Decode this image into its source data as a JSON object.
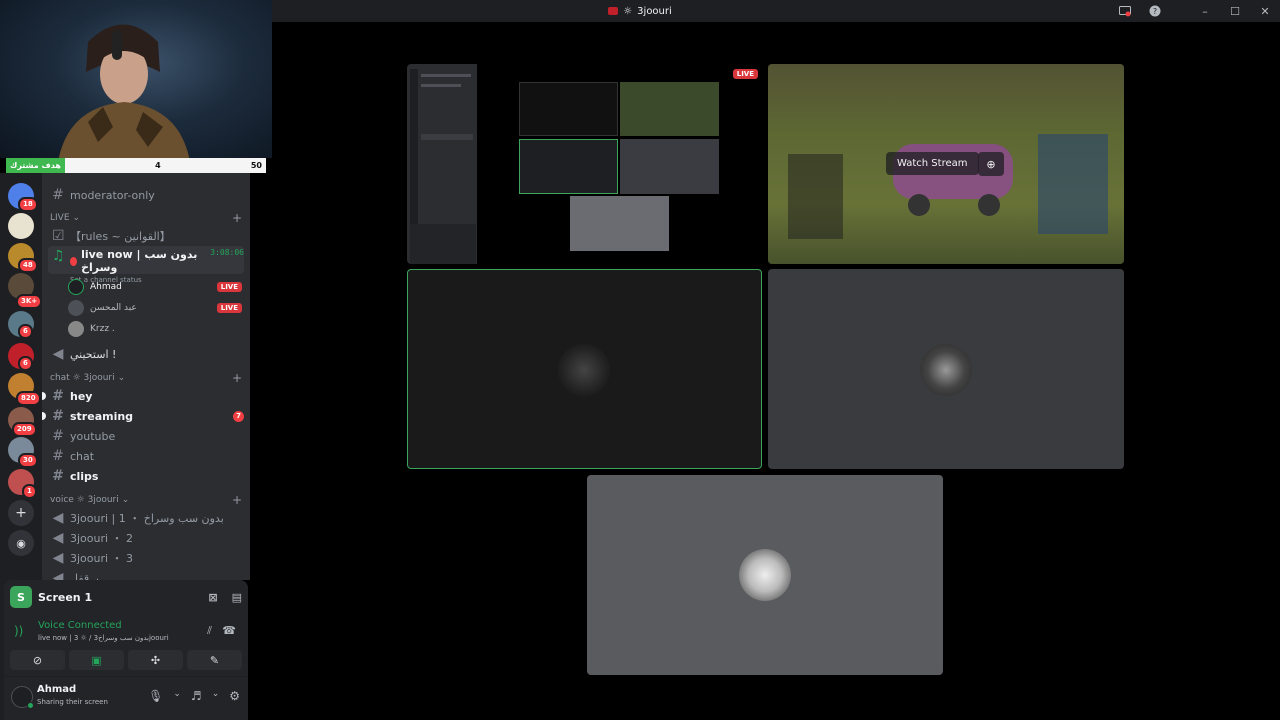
{
  "window": {
    "title": "3joouri"
  },
  "goal": {
    "label": "هدف مشترك",
    "current": "4",
    "target": "50"
  },
  "servers": [
    {
      "badge": "18",
      "color": "#4f7fe8"
    },
    {
      "badge": "",
      "color": "#e8e2d0"
    },
    {
      "badge": "48",
      "color": "#b88a2c"
    },
    {
      "badge": "3K+",
      "color": "#5a4a3a"
    },
    {
      "badge": "6",
      "color": "#5a7a8a"
    },
    {
      "badge": "6",
      "color": "#c0202a"
    },
    {
      "badge": "820",
      "color": "#c08030"
    },
    {
      "badge": "209",
      "color": "#8a5a4a"
    },
    {
      "badge": "30",
      "color": "#7a8a9a"
    },
    {
      "badge": "1",
      "color": "#c05050"
    }
  ],
  "channels": {
    "moderator": "moderator-only",
    "live_category": "LIVE",
    "rules": "【rules ~ القوانين】",
    "live_voice": "live now | بدون سب وسراخ",
    "live_timer": "3:08:06",
    "set_status": "Set a channel status",
    "voice_users": [
      {
        "name": "Ahmad",
        "live": "LIVE"
      },
      {
        "name": "عبد المحسن",
        "live": "LIVE"
      },
      {
        "name": "Krzz .",
        "live": ""
      }
    ],
    "afk": "استحيني !",
    "chat_category": "chat ☼ 3joouri",
    "text": [
      {
        "name": "hey",
        "bold": true,
        "mention": ""
      },
      {
        "name": "streaming",
        "bold": true,
        "mention": "7"
      },
      {
        "name": "youtube",
        "bold": false,
        "mention": ""
      },
      {
        "name": "chat",
        "bold": false,
        "mention": ""
      },
      {
        "name": "clips",
        "bold": true,
        "mention": ""
      }
    ],
    "voice_category": "voice ☼ 3joouri",
    "voice": [
      "3joouri | 1 ・ بدون سب وسراخ",
      "3joouri ・ 2",
      "3joouri ・ 3",
      "بـ قفل..."
    ]
  },
  "panel": {
    "screen_label": "Screen 1",
    "screen_letter": "S",
    "voice_connected": "Voice Connected",
    "voice_channel": "live now | 3 ☼ / بدون سب وسراخ3joouri",
    "user_name": "Ahmad",
    "user_status": "Sharing their screen"
  },
  "stage": {
    "live_label": "LIVE",
    "watch_stream": "Watch Stream"
  }
}
